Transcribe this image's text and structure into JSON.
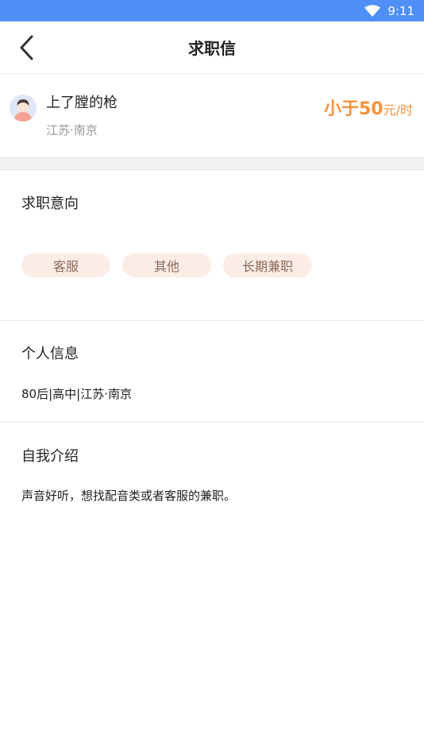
{
  "status_bar": {
    "time": "9:11"
  },
  "nav": {
    "title": "求职信"
  },
  "profile": {
    "name": "上了膛的枪",
    "location": "江苏·南京",
    "salary_amount": "小于50",
    "salary_unit": "元/时"
  },
  "intent": {
    "heading": "求职意向",
    "tags": [
      "客服",
      "其他",
      "长期兼职"
    ]
  },
  "personal": {
    "heading": "个人信息",
    "info": "80后|高中|江苏·南京"
  },
  "intro": {
    "heading": "自我介绍",
    "text": "声音好听，想找配音类或者客服的兼职。"
  },
  "colors": {
    "status_bar": "#4f8ff7",
    "salary": "#f7923d",
    "tag_bg": "#fbece6",
    "tag_text": "#8a6a5a"
  },
  "icons": [
    "wifi-icon",
    "back-arrow-icon",
    "avatar-icon"
  ]
}
